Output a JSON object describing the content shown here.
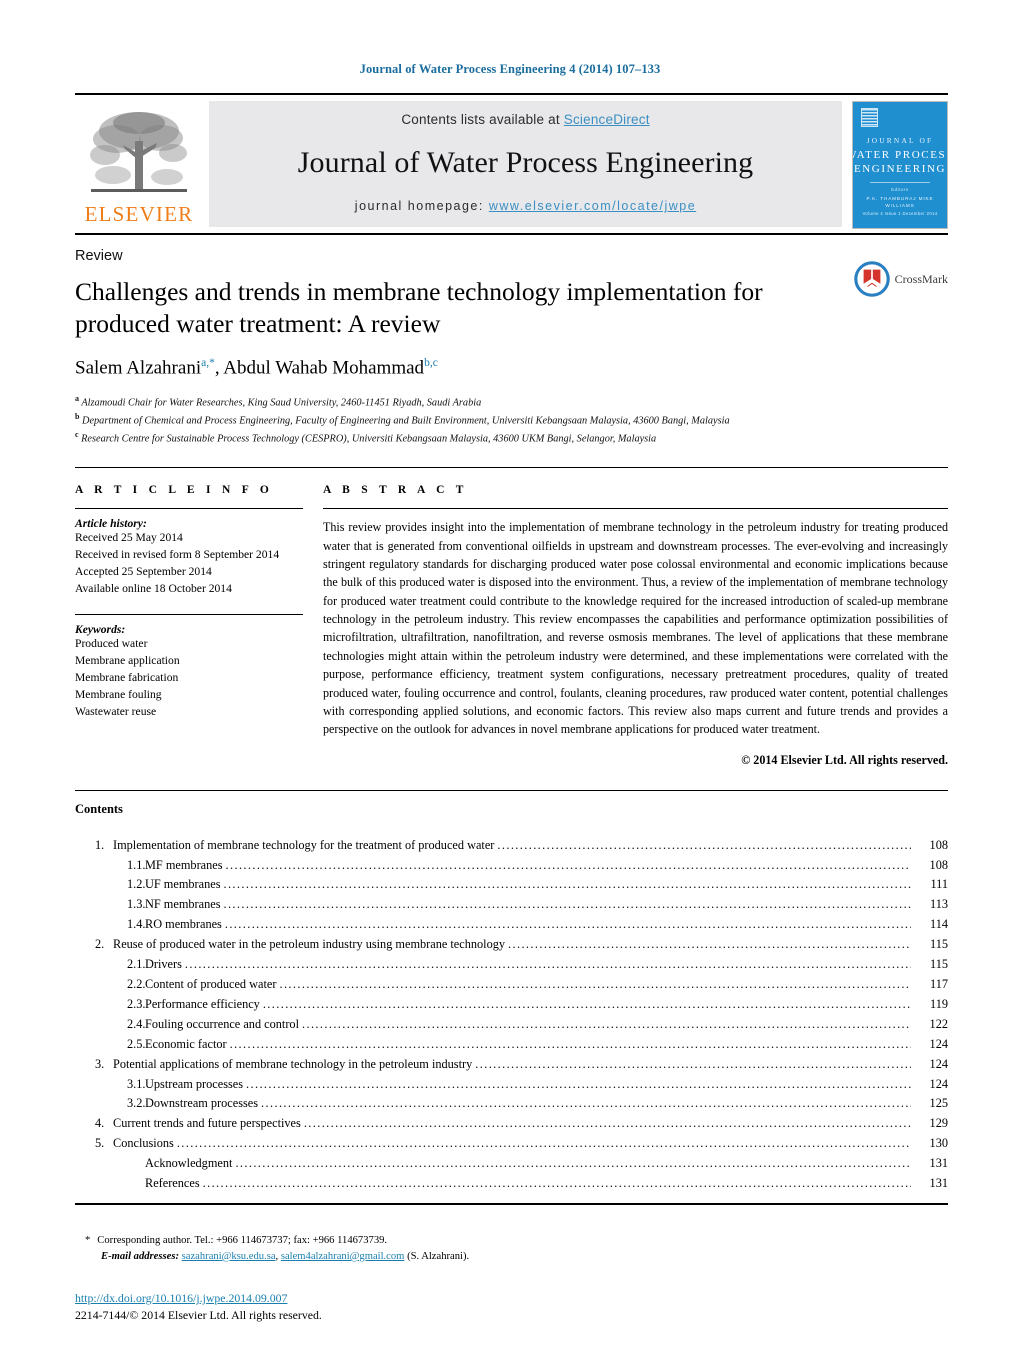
{
  "running_head": "Journal of Water Process Engineering 4 (2014) 107–133",
  "masthead": {
    "contents_prefix": "Contents lists available at ",
    "sciencedirect": "ScienceDirect",
    "journal_title": "Journal of Water Process Engineering",
    "homepage_prefix": "journal homepage: ",
    "homepage_url": "www.elsevier.com/locate/jwpe",
    "publisher_wordmark": "ELSEVIER",
    "cover": {
      "line_of": "JOURNAL OF",
      "line1": "WATER PROCESS",
      "line2": "ENGINEERING",
      "editors_label": "Editors",
      "editors": "P.K. THAMBURAJ     MIKE WILLIAMS",
      "footer": "Volume 4   Issue 1   December 2014"
    },
    "link_color": "#3a8fc4",
    "panel_color": "#e8e8ea",
    "elsevier_orange": "#ef7d19",
    "cover_blue": "#1f8fd0"
  },
  "article": {
    "doctype": "Review",
    "title": "Challenges and trends in membrane technology implementation for produced water treatment: A review",
    "authors": [
      {
        "name": "Salem Alzahrani",
        "marks": "a,*"
      },
      {
        "name": "Abdul Wahab Mohammad",
        "marks": "b,c"
      }
    ],
    "affiliations": [
      {
        "mark": "a",
        "text": "Alzamoudi Chair for Water Researches, King Saud University, 2460-11451 Riyadh, Saudi Arabia"
      },
      {
        "mark": "b",
        "text": "Department of Chemical and Process Engineering, Faculty of Engineering and Built Environment, Universiti Kebangsaan Malaysia, 43600 Bangi, Malaysia"
      },
      {
        "mark": "c",
        "text": "Research Centre for Sustainable Process Technology (CESPRO), Universiti Kebangsaan Malaysia, 43600 UKM Bangi, Selangor, Malaysia"
      }
    ],
    "crossmark_label": "CrossMark"
  },
  "article_info": {
    "heading": "A R T I C L E   I N F O",
    "history_label": "Article history:",
    "history": [
      "Received 25 May 2014",
      "Received in revised form 8 September 2014",
      "Accepted 25 September 2014",
      "Available online 18 October 2014"
    ],
    "keywords_label": "Keywords:",
    "keywords": [
      "Produced water",
      "Membrane application",
      "Membrane fabrication",
      "Membrane fouling",
      "Wastewater reuse"
    ]
  },
  "abstract": {
    "heading": "A B S T R A C T",
    "body": "This review provides insight into the implementation of membrane technology in the petroleum industry for treating produced water that is generated from conventional oilfields in upstream and downstream processes. The ever-evolving and increasingly stringent regulatory standards for discharging produced water pose colossal environmental and economic implications because the bulk of this produced water is disposed into the environment. Thus, a review of the implementation of membrane technology for produced water treatment could contribute to the knowledge required for the increased introduction of scaled-up membrane technology in the petroleum industry. This review encompasses the capabilities and performance optimization possibilities of microfiltration, ultrafiltration, nanofiltration, and reverse osmosis membranes. The level of applications that these membrane technologies might attain within the petroleum industry were determined, and these implementations were correlated with the purpose, performance efficiency, treatment system configurations, necessary pretreatment procedures, quality of treated produced water, fouling occurrence and control, foulants, cleaning procedures, raw produced water content, potential challenges with corresponding applied solutions, and economic factors. This review also maps current and future trends and provides a perspective on the outlook for advances in novel membrane applications for produced water treatment.",
    "copyright": "© 2014 Elsevier Ltd. All rights reserved."
  },
  "contents": {
    "title": "Contents",
    "entries": [
      {
        "level": 1,
        "num": "1.",
        "label": "Implementation of membrane technology for the treatment of produced water",
        "page": "108"
      },
      {
        "level": 2,
        "num": "1.1.",
        "label": "MF membranes",
        "page": "108"
      },
      {
        "level": 2,
        "num": "1.2.",
        "label": "UF membranes",
        "page": "111"
      },
      {
        "level": 2,
        "num": "1.3.",
        "label": "NF membranes",
        "page": "113"
      },
      {
        "level": 2,
        "num": "1.4.",
        "label": "RO membranes",
        "page": "114"
      },
      {
        "level": 1,
        "num": "2.",
        "label": "Reuse of produced water in the petroleum industry using membrane technology",
        "page": "115"
      },
      {
        "level": 2,
        "num": "2.1.",
        "label": "Drivers",
        "page": "115"
      },
      {
        "level": 2,
        "num": "2.2.",
        "label": "Content of produced water",
        "page": "117"
      },
      {
        "level": 2,
        "num": "2.3.",
        "label": "Performance efficiency",
        "page": "119"
      },
      {
        "level": 2,
        "num": "2.4.",
        "label": "Fouling occurrence and control",
        "page": "122"
      },
      {
        "level": 2,
        "num": "2.5.",
        "label": "Economic factor",
        "page": "124"
      },
      {
        "level": 1,
        "num": "3.",
        "label": "Potential applications of membrane technology in the petroleum industry",
        "page": "124"
      },
      {
        "level": 2,
        "num": "3.1.",
        "label": "Upstream processes",
        "page": "124"
      },
      {
        "level": 2,
        "num": "3.2.",
        "label": "Downstream processes",
        "page": "125"
      },
      {
        "level": 1,
        "num": "4.",
        "label": "Current trends and future perspectives",
        "page": "129"
      },
      {
        "level": 1,
        "num": "5.",
        "label": "Conclusions",
        "page": "130"
      },
      {
        "level": 2,
        "num": "",
        "label": "Acknowledgment",
        "page": "131"
      },
      {
        "level": 2,
        "num": "",
        "label": "References",
        "page": "131"
      }
    ]
  },
  "footnotes": {
    "star": "*",
    "corresponding": "Corresponding author. Tel.: +966 114673737; fax: +966 114673739.",
    "email_label": "E-mail addresses:",
    "email1": "sazahrani@ksu.edu.sa",
    "email_sep": ", ",
    "email2": "salem4alzahrani@gmail.com",
    "email_suffix": " (S. Alzahrani).",
    "doi": "http://dx.doi.org/10.1016/j.jwpe.2014.09.007",
    "issn": "2214-7144/© 2014 Elsevier Ltd. All rights reserved."
  }
}
